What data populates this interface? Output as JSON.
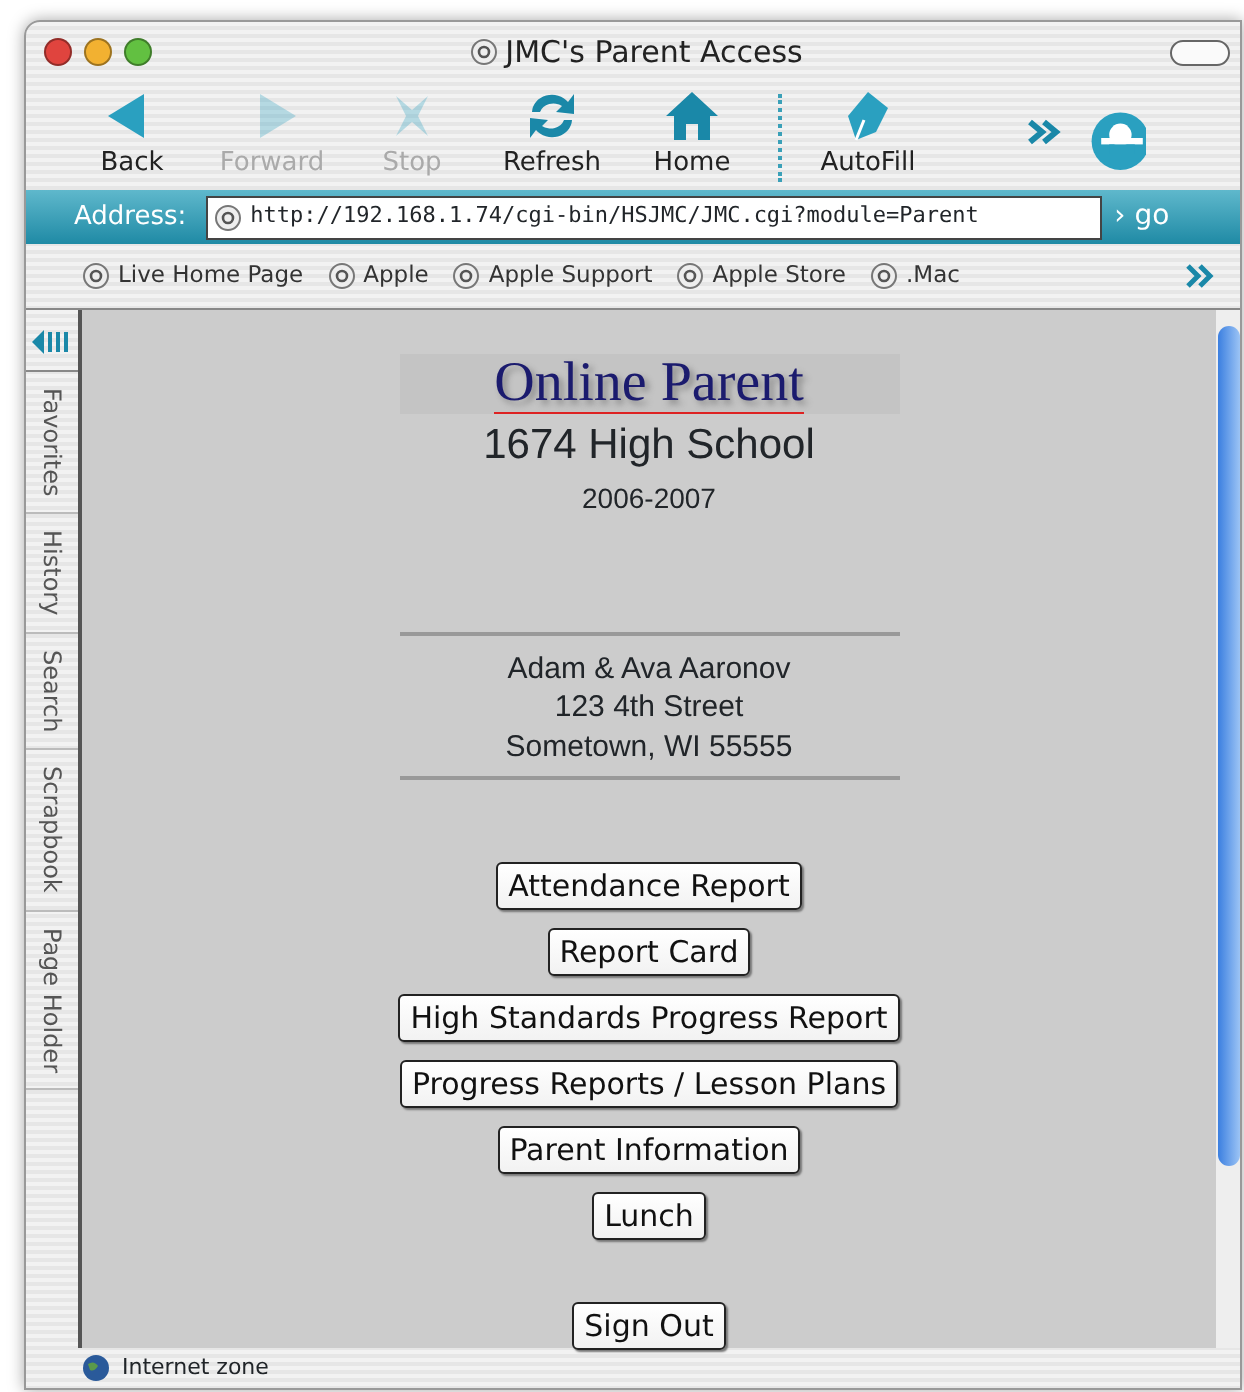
{
  "window": {
    "title": "JMC's Parent Access"
  },
  "toolbar": {
    "buttons": [
      {
        "label": "Back",
        "kind": "back",
        "disabled": false
      },
      {
        "label": "Forward",
        "kind": "forward",
        "disabled": true
      },
      {
        "label": "Stop",
        "kind": "stop",
        "disabled": true
      },
      {
        "label": "Refresh",
        "kind": "refresh",
        "disabled": false
      },
      {
        "label": "Home",
        "kind": "home",
        "disabled": false
      },
      {
        "label": "AutoFill",
        "kind": "autofill",
        "disabled": false
      }
    ]
  },
  "address_bar": {
    "label": "Address:",
    "value": "http://192.168.1.74/cgi-bin/HSJMC/JMC.cgi?module=Parent",
    "go": "› go"
  },
  "favorites_bar": {
    "items": [
      "Live Home Page",
      "Apple",
      "Apple Support",
      "Apple Store",
      ".Mac"
    ]
  },
  "sidebar": {
    "tabs": [
      "Favorites",
      "History",
      "Search",
      "Scrapbook",
      "Page Holder"
    ]
  },
  "page": {
    "logo": "Online Parent",
    "school": "1674 High School",
    "year": "2006-2007",
    "address_lines": [
      "Adam & Ava Aaronov",
      "123 4th Street",
      "Sometown, WI 55555"
    ],
    "buttons": [
      "Attendance Report",
      "Report Card",
      "High Standards Progress Report",
      "Progress Reports / Lesson Plans",
      "Parent Information",
      "Lunch"
    ],
    "sign_out": "Sign Out"
  },
  "status_bar": {
    "text": "Internet zone"
  }
}
